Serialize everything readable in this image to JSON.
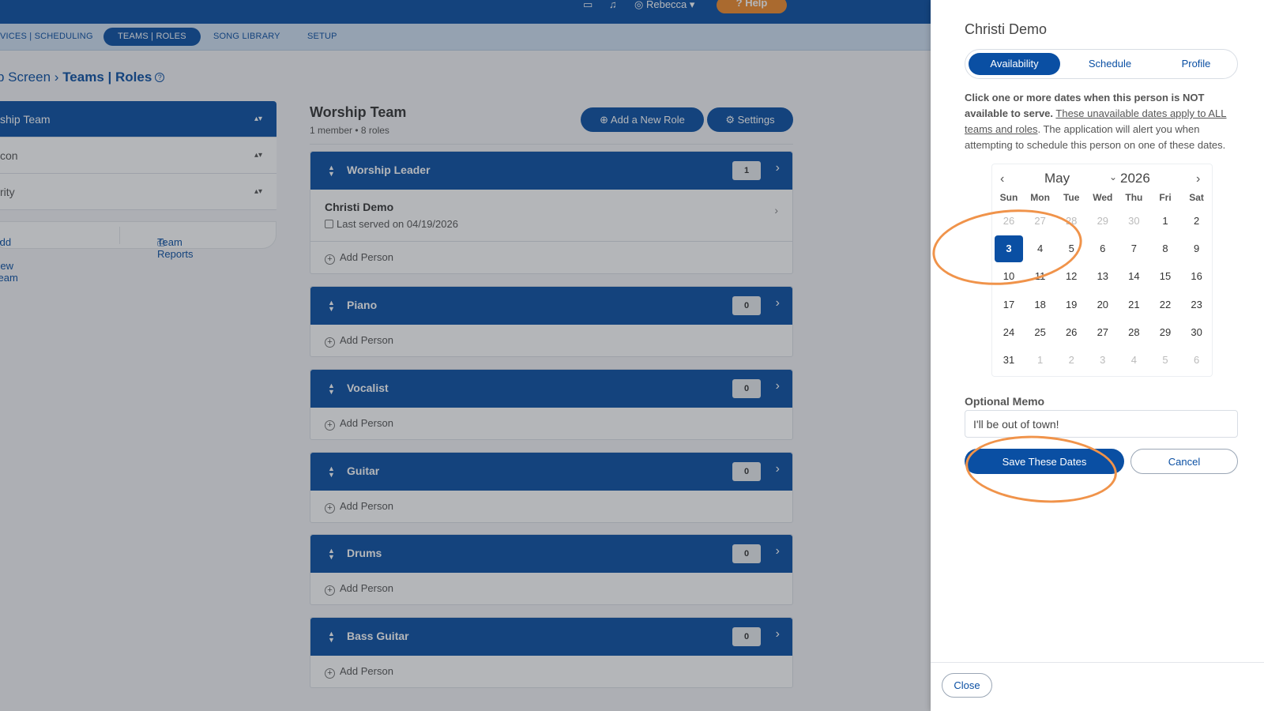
{
  "topbar": {
    "user": "Rebecca",
    "help": "Help"
  },
  "subnav": [
    "VICES | SCHEDULING",
    "TEAMS | ROLES",
    "SONG LIBRARY",
    "SETUP"
  ],
  "breadcrumb": {
    "parent": "p Screen",
    "current": "Teams | Roles"
  },
  "teams": [
    {
      "label": "ship Team",
      "active": true
    },
    {
      "label": "con"
    },
    {
      "label": "rity"
    }
  ],
  "team_actions": {
    "add": "Add a New Team",
    "reports": "Team Reports"
  },
  "main": {
    "title": "Worship Team",
    "subtitle": "1 member • 8 roles",
    "add_role": "Add a New Role",
    "settings": "Settings"
  },
  "roles": [
    {
      "name": "Worship Leader",
      "count": "1",
      "person": "Christi Demo",
      "last_served": "Last served on 04/19/2026"
    },
    {
      "name": "Piano",
      "count": "0"
    },
    {
      "name": "Vocalist",
      "count": "0"
    },
    {
      "name": "Guitar",
      "count": "0"
    },
    {
      "name": "Drums",
      "count": "0"
    },
    {
      "name": "Bass Guitar",
      "count": "0"
    }
  ],
  "add_person": "Add Person",
  "panel": {
    "title": "Christi Demo",
    "tabs": [
      "Availability",
      "Schedule",
      "Profile"
    ],
    "instr_bold": "Click one or more dates when this person is NOT available to serve.",
    "instr_link": "These unavailable dates apply to ALL teams and roles",
    "instr_rest": ". The application will alert you when attempting to schedule this person on one of these dates.",
    "calendar": {
      "month": "May",
      "year": "2026",
      "weekdays": [
        "Sun",
        "Mon",
        "Tue",
        "Wed",
        "Thu",
        "Fri",
        "Sat"
      ],
      "days": [
        "26",
        "27",
        "28",
        "29",
        "30",
        "1",
        "2",
        "3",
        "4",
        "5",
        "6",
        "7",
        "8",
        "9",
        "10",
        "11",
        "12",
        "13",
        "14",
        "15",
        "16",
        "17",
        "18",
        "19",
        "20",
        "21",
        "22",
        "23",
        "24",
        "25",
        "26",
        "27",
        "28",
        "29",
        "30",
        "31",
        "1",
        "2",
        "3",
        "4",
        "5",
        "6"
      ],
      "selected": "3"
    },
    "memo_label": "Optional Memo",
    "memo_value": "I'll be out of town!",
    "save": "Save These Dates",
    "cancel": "Cancel",
    "close": "Close"
  },
  "colors": {
    "brand": "#0a4fa3",
    "help": "#f08a2b",
    "annotation": "#f0934a"
  }
}
